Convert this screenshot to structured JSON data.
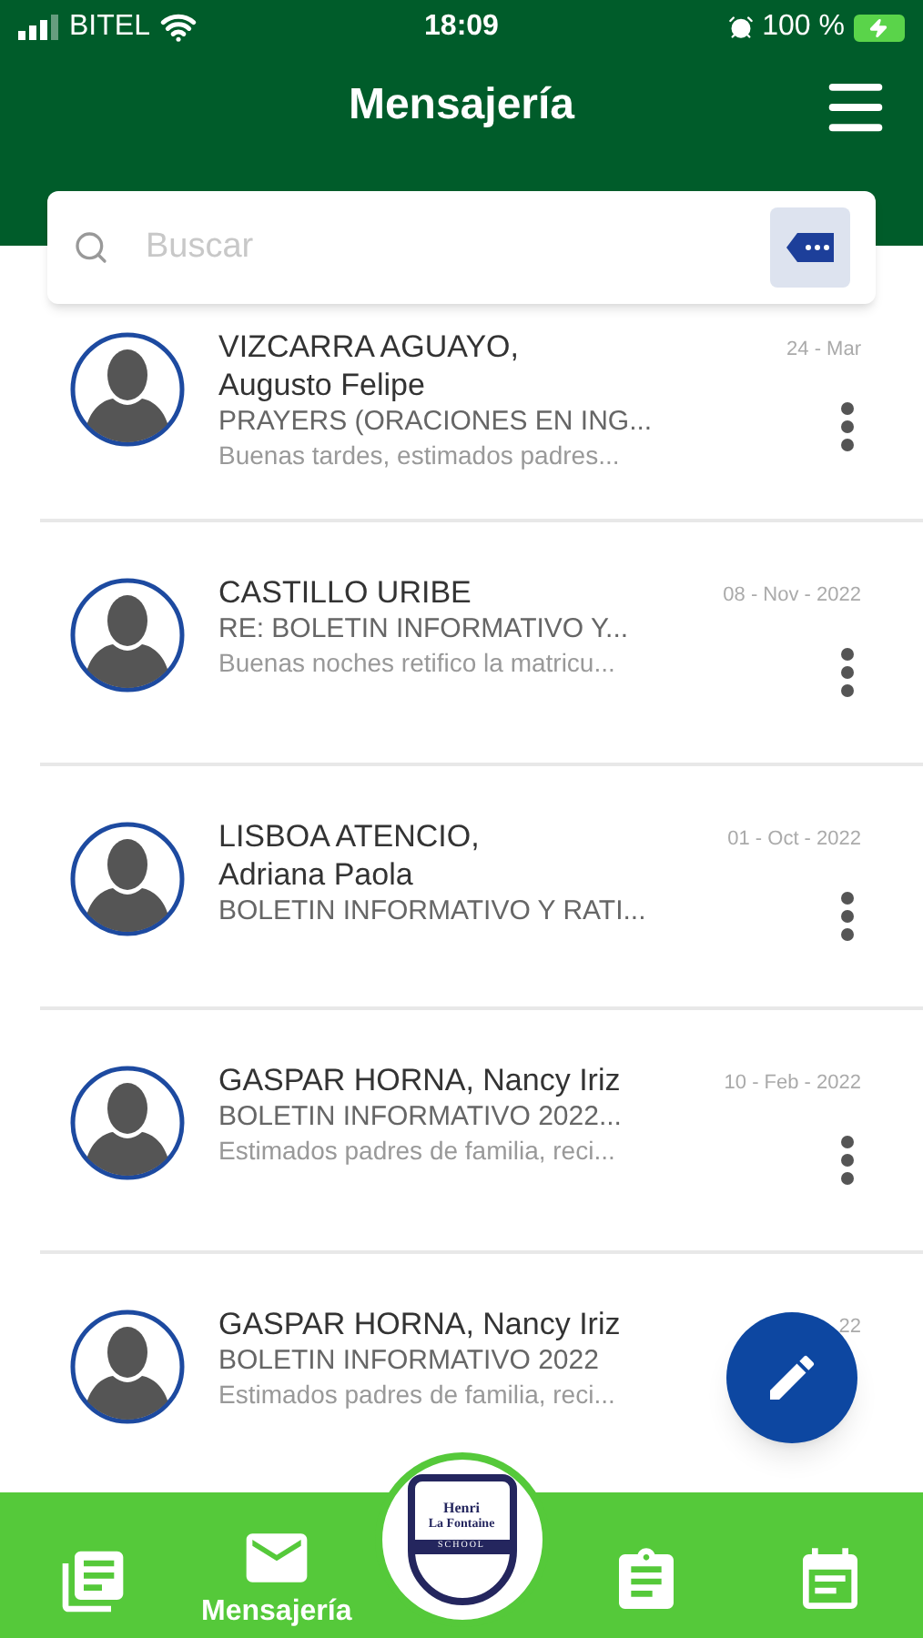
{
  "status_bar": {
    "carrier": "BITEL",
    "time": "18:09",
    "battery": "100 %"
  },
  "header": {
    "title": "Mensajería"
  },
  "search": {
    "placeholder": "Buscar"
  },
  "messages": [
    {
      "name": "VIZCARRA AGUAYO,\nAugusto Felipe",
      "date": "24 - Mar",
      "subject": "PRAYERS (ORACIONES EN ING...",
      "preview": "Buenas tardes, estimados padres...",
      "menu": true
    },
    {
      "name": "CASTILLO URIBE",
      "date": "08 - Nov - 2022",
      "subject": "RE: BOLETIN INFORMATIVO Y...",
      "preview": "Buenas noches retifico la matricu...",
      "menu": true
    },
    {
      "name": "LISBOA ATENCIO,\nAdriana Paola",
      "date": "01 - Oct - 2022",
      "subject": "BOLETIN INFORMATIVO Y RATI...",
      "menu": true
    },
    {
      "name": "GASPAR HORNA, Nancy Iriz",
      "date": "10 - Feb - 2022",
      "subject": "BOLETIN INFORMATIVO 2022...",
      "preview": "Estimados padres de familia, reci...",
      "menu": true
    },
    {
      "name": "GASPAR HORNA, Nancy Iriz",
      "date": "22",
      "subject": "BOLETIN INFORMATIVO 2022",
      "preview": "Estimados padres de familia, reci...",
      "menu": false
    }
  ],
  "logo": {
    "line1": "Henri",
    "line2": "La Fontaine",
    "line3": "SCHOOL"
  },
  "nav": [
    {
      "kind": "books",
      "selected": false
    },
    {
      "kind": "mail",
      "label": "Mensajería",
      "selected": true
    },
    {
      "kind": "logo",
      "selected": false
    },
    {
      "kind": "clipboard",
      "selected": false
    },
    {
      "kind": "calendar",
      "selected": false
    }
  ]
}
